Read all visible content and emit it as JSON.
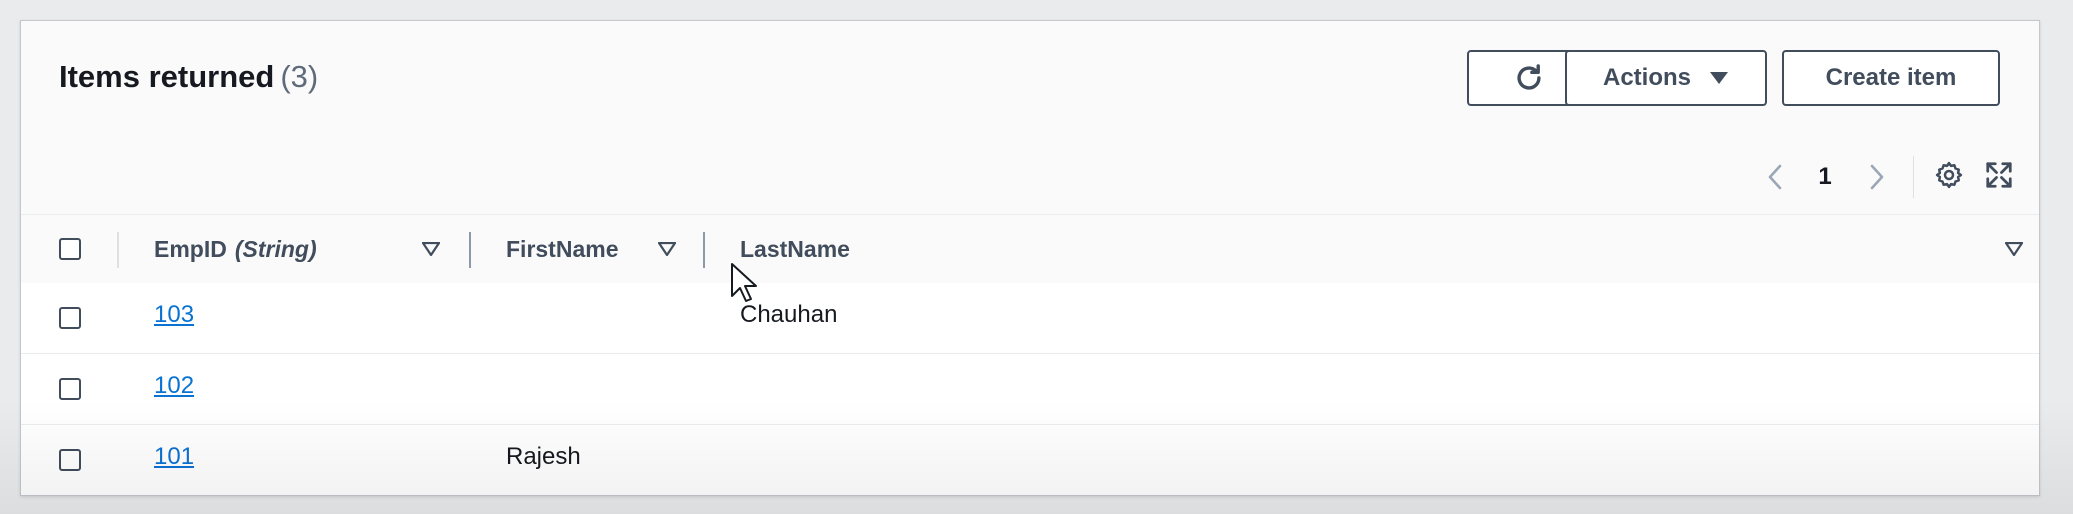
{
  "header": {
    "title": "Items returned",
    "count": "(3)",
    "actions_label": "Actions",
    "create_label": "Create item"
  },
  "pagination": {
    "current_page": "1"
  },
  "table": {
    "columns": [
      {
        "label": "EmpID",
        "type_hint": "(String)"
      },
      {
        "label": "FirstName"
      },
      {
        "label": "LastName"
      }
    ],
    "rows": [
      {
        "empid": "103",
        "firstname": "",
        "lastname": "Chauhan"
      },
      {
        "empid": "102",
        "firstname": "",
        "lastname": ""
      },
      {
        "empid": "101",
        "firstname": "Rajesh",
        "lastname": ""
      }
    ]
  },
  "icons": [
    "refresh-icon",
    "caret-down-icon",
    "chevron-left-icon",
    "chevron-right-icon",
    "gear-icon",
    "expand-icon",
    "sort-icon",
    "mouse-cursor-icon"
  ],
  "colors": {
    "link": "#0972d3",
    "button_border": "#414d5c",
    "header_bg": "#fafafa"
  }
}
